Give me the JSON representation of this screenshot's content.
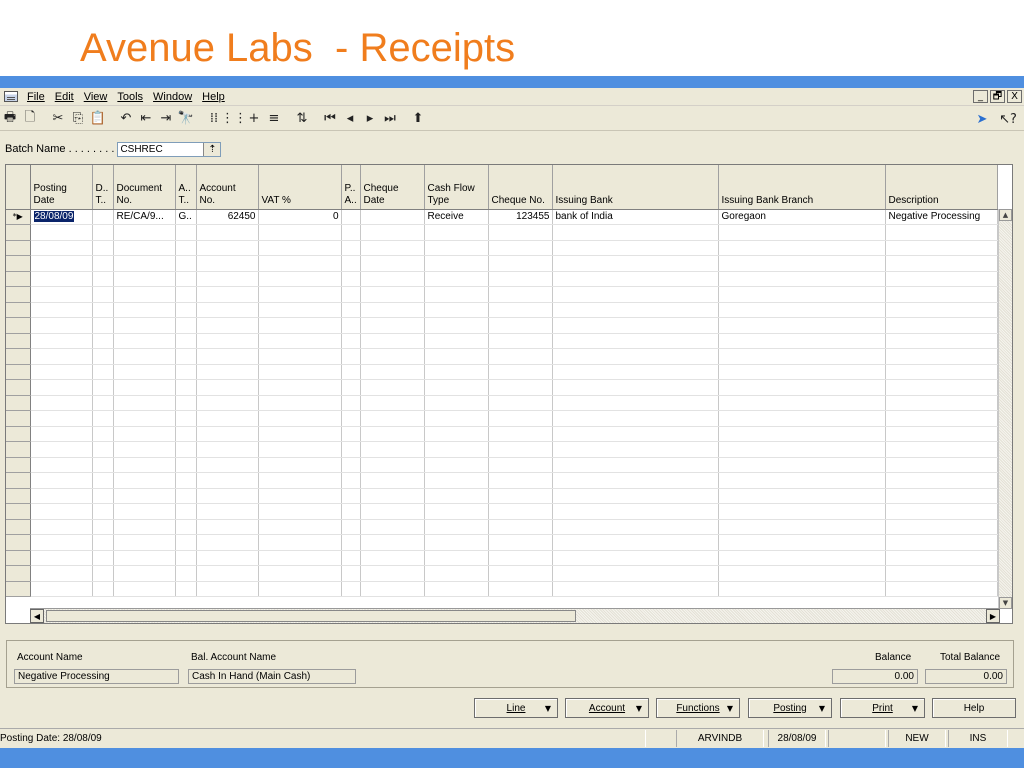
{
  "slide": {
    "title": "Avenue Labs  - Receipts"
  },
  "menu": [
    "File",
    "Edit",
    "View",
    "Tools",
    "Window",
    "Help"
  ],
  "window_controls": [
    "_",
    "🗗",
    "X"
  ],
  "batch": {
    "label": "Batch Name . . . . . . . .",
    "value": "CSHREC"
  },
  "grid": {
    "columns": [
      "Posting\nDate",
      "D..\nT..",
      "Document\nNo.",
      "A..\nT..",
      "Account\nNo.",
      "VAT %",
      "P..\nA..",
      "Cheque\nDate",
      "Cash Flow\nType",
      "Cheque No.",
      "Issuing Bank",
      "Issuing Bank Branch",
      "Description"
    ],
    "rows": [
      [
        "28/08/09",
        "",
        "RE/CA/9...",
        "G..",
        "62450",
        "0",
        "",
        "",
        "Receive",
        "123455",
        "bank of India",
        "Goregaon",
        "Negative Processing"
      ]
    ],
    "row_marker": "*▶"
  },
  "info": {
    "account_name_label": "Account Name",
    "account_name": "Negative Processing",
    "bal_account_name_label": "Bal. Account Name",
    "bal_account_name": "Cash In Hand (Main Cash)",
    "balance_label": "Balance",
    "balance": "0.00",
    "total_balance_label": "Total Balance",
    "total_balance": "0.00"
  },
  "buttons": {
    "line": "Line",
    "account": "Account",
    "functions": "Functions",
    "posting": "Posting",
    "print": "Print",
    "help": "Help"
  },
  "status": {
    "posting_date": "Posting Date: 28/08/09",
    "user": "ARVINDB",
    "date": "28/08/09",
    "mode_new": "NEW",
    "mode_ins": "INS"
  }
}
